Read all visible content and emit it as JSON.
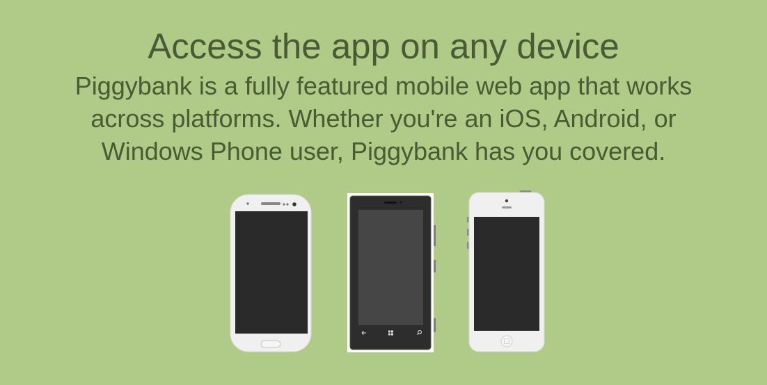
{
  "section": {
    "headline": "Access the app on any device",
    "description": "Piggybank is a fully featured mobile web app that works across platforms. Whether you're an iOS, Android, or Windows Phone user, Piggybank has you covered."
  },
  "devices": [
    {
      "name": "android-phone",
      "icon": "android-phone-icon"
    },
    {
      "name": "windows-phone",
      "icon": "windows-phone-icon"
    },
    {
      "name": "iphone",
      "icon": "iphone-icon"
    }
  ],
  "colors": {
    "background": "#afcb87",
    "text": "#4a5a35",
    "screen": "#2a2a2a",
    "device_body": "#efefef"
  }
}
